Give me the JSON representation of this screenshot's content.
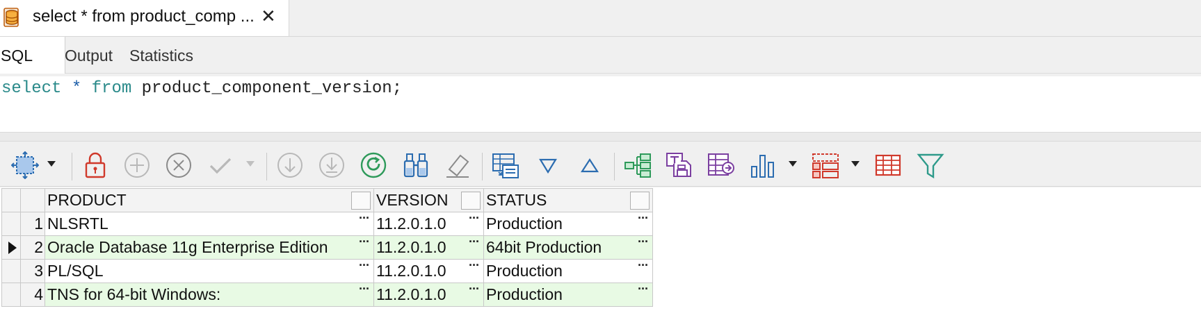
{
  "tab": {
    "title": "select * from product_comp ...",
    "close_glyph": "✕"
  },
  "subtabs": [
    "SQL",
    "Output",
    "Statistics"
  ],
  "editor": {
    "kw_select": "select",
    "star": " * ",
    "kw_from": "from",
    "rest": " product_component_version;"
  },
  "toolbar": {
    "icons": [
      "grid-select-icon",
      "lock-icon",
      "add-record-icon",
      "delete-record-icon",
      "post-edit-icon",
      "fetch-next-icon",
      "fetch-all-icon",
      "refresh-icon",
      "find-icon",
      "clear-icon",
      "single-record-view-icon",
      "sort-descending-icon",
      "sort-ascending-icon",
      "tree-view-icon",
      "export-text-icon",
      "export-grid-icon",
      "chart-icon",
      "layout-icon",
      "grid-view-icon",
      "filter-icon"
    ]
  },
  "grid": {
    "columns": [
      "PRODUCT",
      "VERSION",
      "STATUS"
    ],
    "rows": [
      {
        "num": "1",
        "product": "NLSRTL",
        "version": "11.2.0.1.0",
        "status": "Production"
      },
      {
        "num": "2",
        "product": "Oracle Database 11g Enterprise Edition",
        "version": "11.2.0.1.0",
        "status": "64bit Production"
      },
      {
        "num": "3",
        "product": "PL/SQL",
        "version": "11.2.0.1.0",
        "status": "Production"
      },
      {
        "num": "4",
        "product": "TNS for 64-bit Windows:",
        "version": "11.2.0.1.0",
        "status": "Production"
      }
    ],
    "ellipsis": "···",
    "current_row": 2
  },
  "colors": {
    "alt_row": "#e8fae4",
    "accent_red": "#d0392b",
    "accent_blue": "#2b6cb0",
    "accent_green": "#2e9a5a",
    "accent_purple": "#7b3fa0"
  }
}
